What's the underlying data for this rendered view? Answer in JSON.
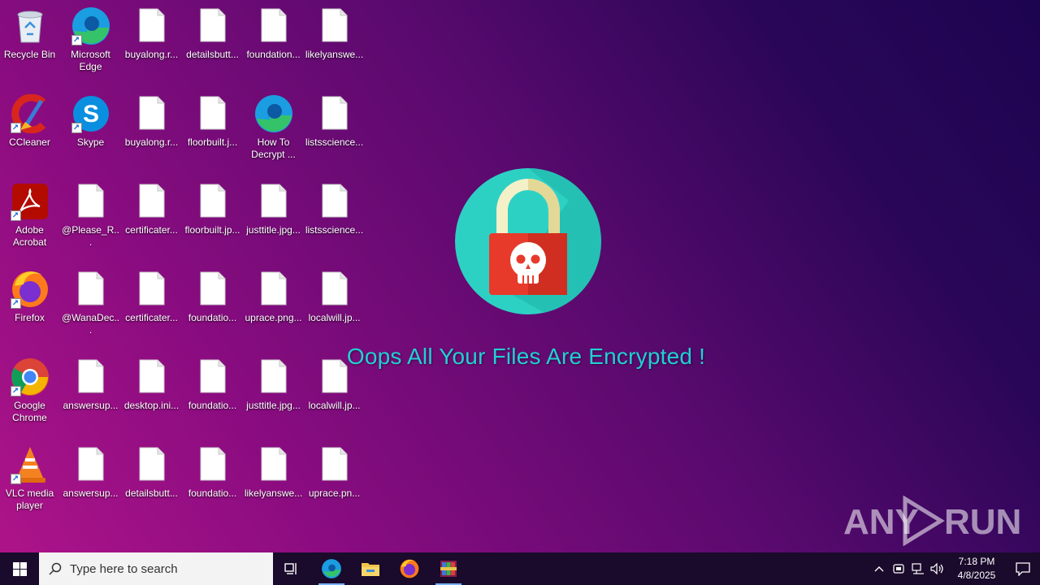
{
  "desktop_icons": [
    {
      "label": "Recycle Bin",
      "icon": "recycle-bin-icon"
    },
    {
      "label": "Microsoft Edge",
      "icon": "edge-icon",
      "shortcut": true
    },
    {
      "label": "buyalong.r...",
      "icon": "file-icon"
    },
    {
      "label": "detailsbutt...",
      "icon": "file-icon"
    },
    {
      "label": "foundation...",
      "icon": "file-icon"
    },
    {
      "label": "likelyanswe...",
      "icon": "file-icon"
    },
    {
      "label": "CCleaner",
      "icon": "ccleaner-icon",
      "shortcut": true
    },
    {
      "label": "Skype",
      "icon": "skype-icon",
      "shortcut": true
    },
    {
      "label": "buyalong.r...",
      "icon": "file-icon"
    },
    {
      "label": "floorbuilt.j...",
      "icon": "file-icon"
    },
    {
      "label": "How To Decrypt ...",
      "icon": "edge-icon"
    },
    {
      "label": "listsscience...",
      "icon": "file-icon"
    },
    {
      "label": "Adobe Acrobat",
      "icon": "acrobat-icon",
      "shortcut": true
    },
    {
      "label": "@Please_R...",
      "icon": "file-icon"
    },
    {
      "label": "certificater...",
      "icon": "file-icon"
    },
    {
      "label": "floorbuilt.jp...",
      "icon": "file-icon"
    },
    {
      "label": "justtitle.jpg...",
      "icon": "file-icon"
    },
    {
      "label": "listsscience...",
      "icon": "file-icon"
    },
    {
      "label": "Firefox",
      "icon": "firefox-icon",
      "shortcut": true
    },
    {
      "label": "@WanaDec...",
      "icon": "file-icon"
    },
    {
      "label": "certificater...",
      "icon": "file-icon"
    },
    {
      "label": "foundatio...",
      "icon": "file-icon"
    },
    {
      "label": "uprace.png...",
      "icon": "file-icon"
    },
    {
      "label": "localwill.jp...",
      "icon": "file-icon"
    },
    {
      "label": "Google Chrome",
      "icon": "chrome-icon",
      "shortcut": true
    },
    {
      "label": "answersup...",
      "icon": "file-icon"
    },
    {
      "label": "desktop.ini...",
      "icon": "file-icon"
    },
    {
      "label": "foundatio...",
      "icon": "file-icon"
    },
    {
      "label": "justtitle.jpg...",
      "icon": "file-icon"
    },
    {
      "label": "localwill.jp...",
      "icon": "file-icon"
    },
    {
      "label": "VLC media player",
      "icon": "vlc-icon",
      "shortcut": true
    },
    {
      "label": "answersup...",
      "icon": "file-icon"
    },
    {
      "label": "detailsbutt...",
      "icon": "file-icon"
    },
    {
      "label": "foundatio...",
      "icon": "file-icon"
    },
    {
      "label": "likelyanswe...",
      "icon": "file-icon"
    },
    {
      "label": "uprace.pn...",
      "icon": "file-icon"
    }
  ],
  "wallpaper": {
    "message": "Oops All Your Files Are Encrypted !",
    "icon": "skull-padlock-icon",
    "accent": "#21d0d4",
    "lock_body": "#e83a2a"
  },
  "watermark": {
    "left": "ANY",
    "right": "RUN"
  },
  "taskbar": {
    "search_placeholder": "Type here to search",
    "apps": [
      "task-view-icon",
      "edge-icon",
      "file-explorer-icon",
      "firefox-icon",
      "winrar-icon"
    ],
    "time": "7:18 PM",
    "date": "4/8/2025"
  }
}
